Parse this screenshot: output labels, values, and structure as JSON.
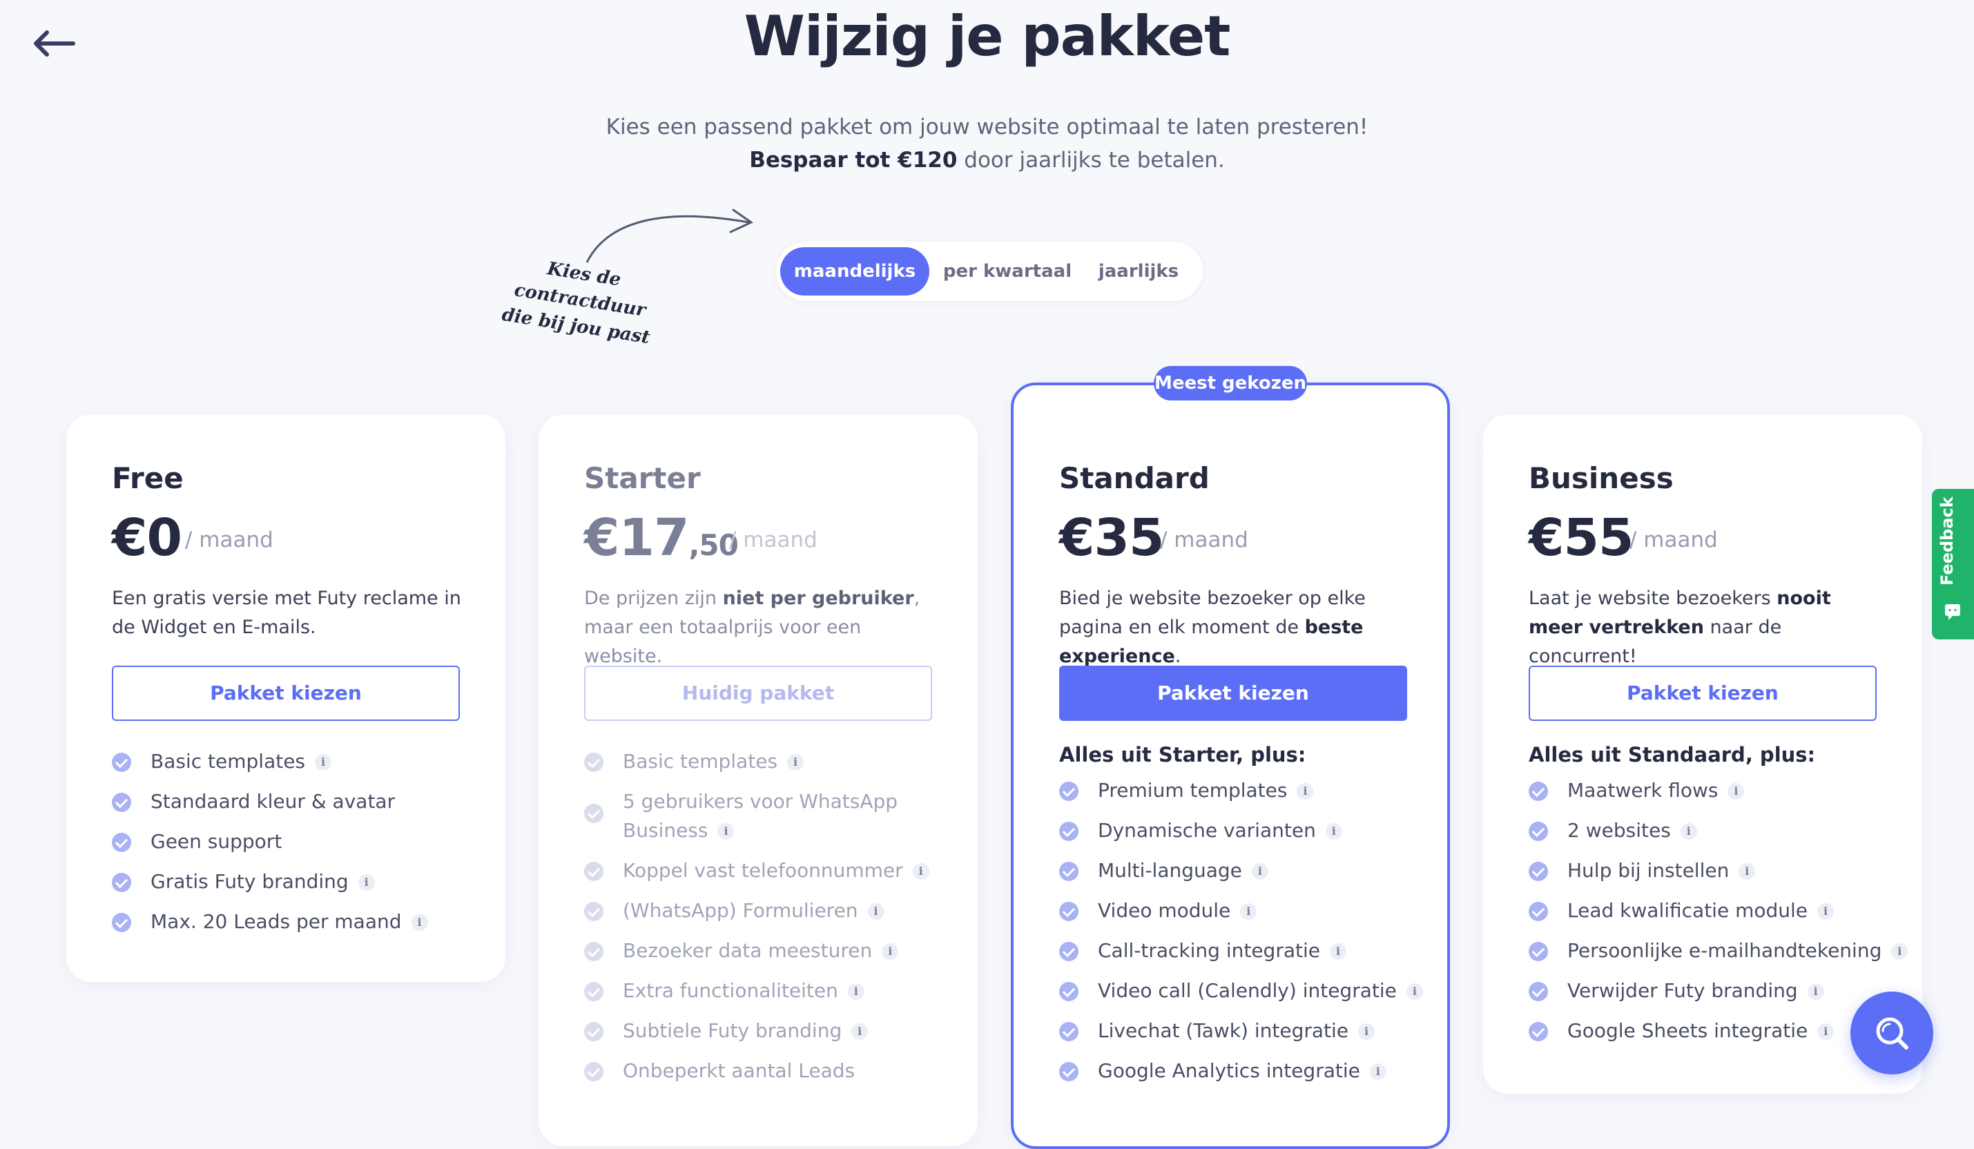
{
  "header": {
    "title": "Wijzig je pakket",
    "subtitle_line1": "Kies een passend pakket om jouw website optimaal te laten presteren!",
    "subtitle_bold": "Bespaar tot €120",
    "subtitle_rest": " door jaarlijks te betalen."
  },
  "hint": {
    "line1": "Kies de contractduur",
    "line2": "die bij jou past"
  },
  "billing_toggle": {
    "options": [
      "maandelijks",
      "per kwartaal",
      "jaarlijks"
    ],
    "selected": "maandelijks"
  },
  "featured_badge": "Meest gekozen",
  "per_month": "/ maand",
  "plans": [
    {
      "name": "Free",
      "price": "€0",
      "desc_a": "Een gratis versie met Futy reclame in de Widget en E-mails.",
      "button": "Pakket kiezen",
      "features": [
        "Basic templates",
        "Standaard kleur & avatar",
        "Geen support",
        "Gratis Futy branding",
        "Max. 20 Leads per maand"
      ]
    },
    {
      "name": "Starter",
      "price_main": "€17",
      "price_cents": ",50",
      "desc_a": "De prijzen zijn ",
      "desc_b": "niet per gebruiker",
      "desc_c": ", maar een totaalprijs voor een website.",
      "button": "Huidig pakket",
      "features": [
        "Basic templates",
        "5 gebruikers voor WhatsApp Business",
        "Koppel vast telefoonnummer",
        "(WhatsApp) Formulieren",
        "Bezoeker data meesturen",
        "Extra functionaliteiten",
        "Subtiele Futy branding",
        "Onbeperkt aantal Leads"
      ]
    },
    {
      "name": "Standard",
      "price": "€35",
      "desc_a": "Bied je website bezoeker op elke pagina en elk moment de ",
      "desc_b": "beste experience",
      "desc_c": ".",
      "button": "Pakket kiezen",
      "plus_label": "Alles uit Starter, plus:",
      "features": [
        "Premium templates",
        "Dynamische varianten",
        "Multi-language",
        "Video module",
        "Call-tracking integratie",
        "Video call (Calendly) integratie",
        "Livechat (Tawk) integratie",
        "Google Analytics integratie"
      ]
    },
    {
      "name": "Business",
      "price": "€55",
      "desc_a": "Laat je website bezoekers ",
      "desc_b": "nooit meer vertrekken",
      "desc_c": " naar de concurrent!",
      "button": "Pakket kiezen",
      "plus_label": "Alles uit Standaard, plus:",
      "features": [
        "Maatwerk flows",
        "2 websites",
        "Hulp bij instellen",
        "Lead kwalificatie module",
        "Persoonlijke e-mailhandtekening",
        "Verwijder Futy branding",
        "Google Sheets integratie"
      ]
    }
  ],
  "feedback_tab": {
    "label": "Feedback"
  },
  "colors": {
    "accent": "#5b6ef5",
    "feedback": "#1fb46a",
    "background": "#f7f8fc"
  },
  "icons": {
    "back": "arrow-left-icon",
    "check": "check-circle-icon",
    "info": "info-icon",
    "search": "search-icon"
  }
}
